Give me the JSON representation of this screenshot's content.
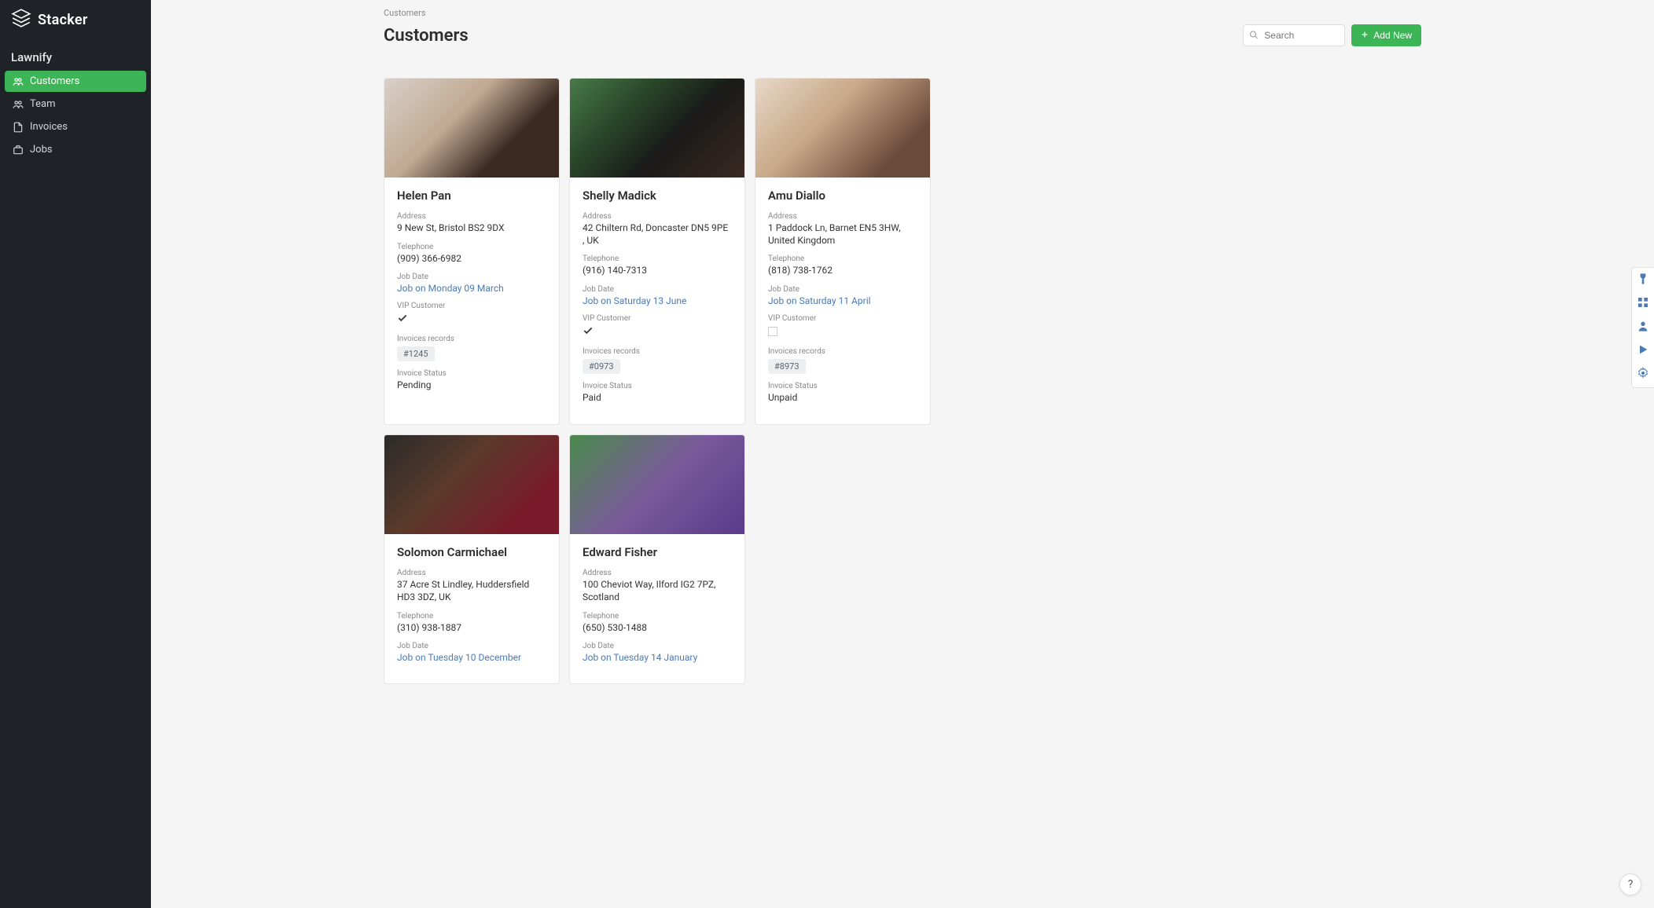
{
  "brand": "Stacker",
  "app_name": "Lawnify",
  "nav": [
    {
      "id": "customers",
      "label": "Customers",
      "active": true,
      "icon": "users"
    },
    {
      "id": "team",
      "label": "Team",
      "active": false,
      "icon": "users"
    },
    {
      "id": "invoices",
      "label": "Invoices",
      "active": false,
      "icon": "file"
    },
    {
      "id": "jobs",
      "label": "Jobs",
      "active": false,
      "icon": "briefcase"
    }
  ],
  "breadcrumb": "Customers",
  "page_title": "Customers",
  "search": {
    "placeholder": "Search",
    "value": ""
  },
  "add_button": "Add New",
  "field_labels": {
    "address": "Address",
    "telephone": "Telephone",
    "job_date": "Job Date",
    "vip": "VIP Customer",
    "invoices": "Invoices records",
    "invoice_status": "Invoice Status"
  },
  "customers": [
    {
      "name": "Helen Pan",
      "address": "9 New St, Bristol BS2 9DX",
      "telephone": "(909) 366-6982",
      "job_date": "Job on Monday 09 March",
      "vip": true,
      "invoice_tag": "#1245",
      "invoice_status": "Pending",
      "img": "p1"
    },
    {
      "name": "Shelly Madick",
      "address": "42 Chiltern Rd, Doncaster DN5 9PE , UK",
      "telephone": "(916) 140-7313",
      "job_date": "Job on Saturday 13 June",
      "vip": true,
      "invoice_tag": "#0973",
      "invoice_status": "Paid",
      "img": "p2"
    },
    {
      "name": "Amu Diallo",
      "address": "1 Paddock Ln, Barnet EN5 3HW, United Kingdom",
      "telephone": "(818) 738-1762",
      "job_date": "Job on Saturday 11 April",
      "vip": false,
      "invoice_tag": "#8973",
      "invoice_status": "Unpaid",
      "img": "p3"
    },
    {
      "name": "Solomon Carmichael",
      "address": "37 Acre St Lindley, Huddersfield HD3 3DZ, UK",
      "telephone": "(310) 938-1887",
      "job_date": "Job on Tuesday 10 December",
      "vip": null,
      "invoice_tag": null,
      "invoice_status": null,
      "img": "p4"
    },
    {
      "name": "Edward Fisher",
      "address": "100 Cheviot Way, Ilford IG2 7PZ, Scotland",
      "telephone": "(650) 530-1488",
      "job_date": "Job on Tuesday 14 January",
      "vip": null,
      "invoice_tag": null,
      "invoice_status": null,
      "img": "p5"
    }
  ],
  "right_tools": [
    "paint",
    "grid",
    "user",
    "play",
    "gear"
  ],
  "help": "?"
}
